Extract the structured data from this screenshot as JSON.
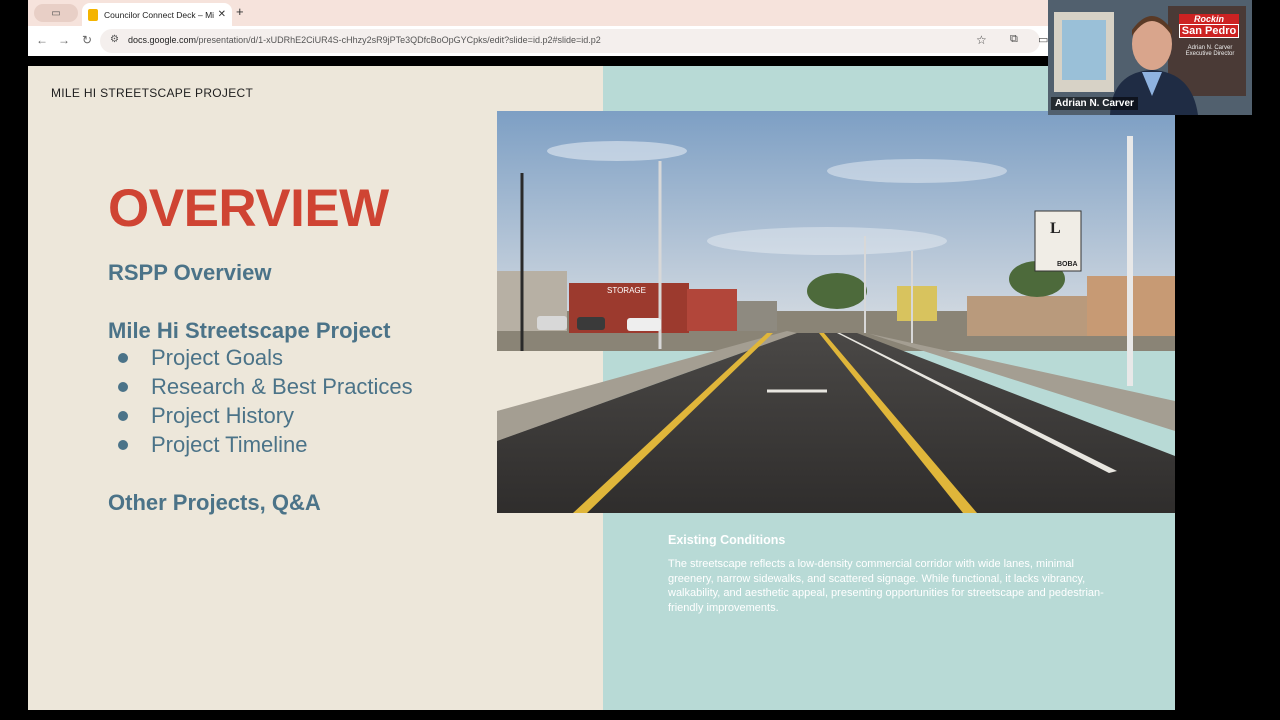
{
  "browser": {
    "tab_title": "Councilor Connect Deck – Mi",
    "tab_close": "✕",
    "new_tab": "+",
    "url_host": "docs.google.com",
    "url_path": "/presentation/d/1-xUDRhE2CiUR4S-cHhzy2sR9jPTe3QDfcBoOpGYCpks/edit?slide=id.p2#slide=id.p2",
    "nav": {
      "back": "←",
      "forward": "→",
      "reload": "↻"
    },
    "icons": {
      "star": "☆",
      "extensions": "⧉",
      "sidepanel": "▭",
      "site_info": "⚙",
      "tab_switch": "▭"
    }
  },
  "slide": {
    "project_label": "MILE HI STREETSCAPE PROJECT",
    "title": "OVERVIEW",
    "section_rspp": "RSPP Overview",
    "section_mile_hi": "Mile Hi Streetscape Project",
    "bullets": [
      "Project Goals",
      "Research & Best Practices",
      "Project History",
      "Project Timeline"
    ],
    "section_other": "Other Projects, Q&A",
    "sign_storage": "STORAGE",
    "sign_restaurant_letter": "L",
    "sign_boba": "BOBA",
    "caption_title": "Existing Conditions",
    "caption_body": "The streetscape reflects a low-density commercial corridor with wide lanes, minimal greenery, narrow sidewalks, and scattered signage. While functional, it lacks vibrancy, walkability, and aesthetic appeal, presenting opportunities for streetscape and pedestrian-friendly improvements."
  },
  "webcam": {
    "participant_name": "Adrian N. Carver",
    "brand_top": "Rockin",
    "brand_bottom": "San Pedro",
    "person_name": "Adrian N. Carver",
    "person_role": "Executive Director"
  },
  "colors": {
    "title_red": "#cf4433",
    "heading_blue": "#4b7388",
    "slide_left_bg": "#ede7da",
    "slide_right_bg": "#b8dad6",
    "chrome_bg": "#f6e3dc"
  }
}
